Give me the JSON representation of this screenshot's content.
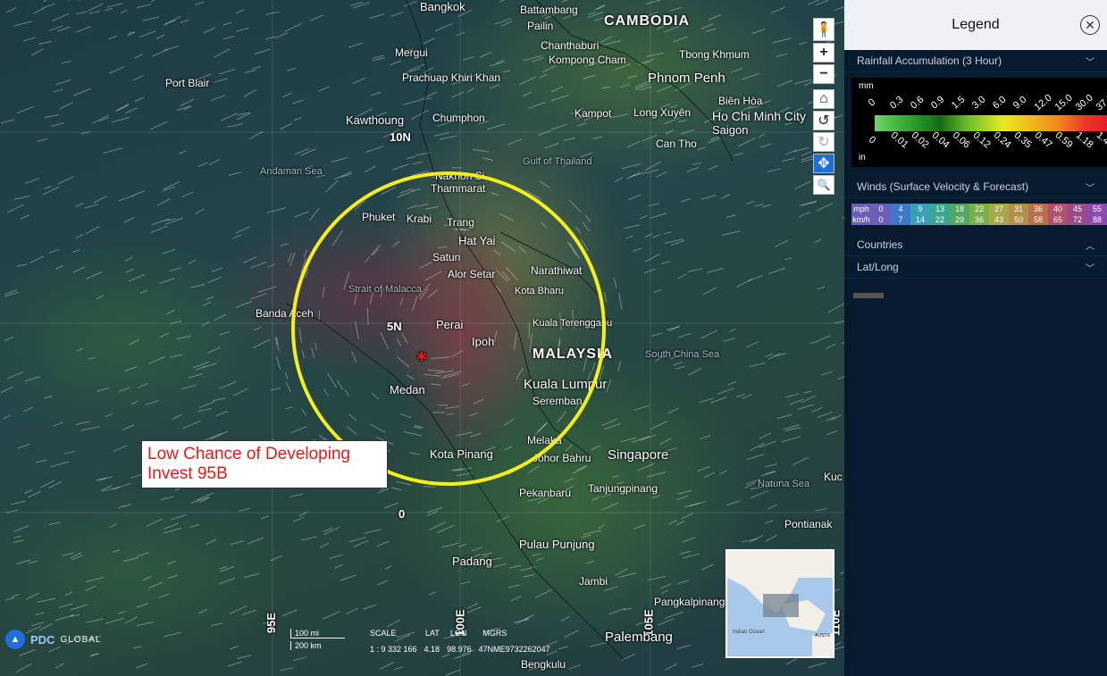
{
  "map": {
    "labels": {
      "bangkok": "Bangkok",
      "battambang": "Battambang",
      "pailin": "Pailin",
      "cambodia": "CAMBODIA",
      "chanthaburi": "Chanthaburi",
      "kompong_cham": "Kompong Cham",
      "tbong_khmum": "Tbong Khmum",
      "mergui": "Mergui",
      "prachuap": "Prachuap Khiri Khan",
      "phnom_penh": "Phnom Penh",
      "port_blair": "Port Blair",
      "bien_hoa": "Biên Hòa",
      "hcmc": "Ho Chi Minh City",
      "saigon": "Saigon",
      "kawthoung": "Kawthoung",
      "chumphon": "Chumphon",
      "kampot": "Kampot",
      "long_xuyen": "Long Xuyên",
      "lat10": "10N",
      "can_tho": "Can Tho",
      "andaman": "Andaman Sea",
      "gulf": "Gulf of Thailand",
      "nakhon": "Nakhon Si",
      "thammarat": "Thammarat",
      "phuket": "Phuket",
      "krabi": "Krabi",
      "trang": "Trang",
      "hat_yai": "Hat Yai",
      "satun": "Satun",
      "alor_setar": "Alor Setar",
      "narathiwat": "Narathiwat",
      "strait": "Strait of Malacca",
      "kota_bharu": "Kota Bharu",
      "banda_aceh": "Banda Aceh",
      "lat5": "5N",
      "perai": "Perai",
      "kuala_terengganu": "Kuala Terengganu",
      "ipoh": "Ipoh",
      "malaysia": "MALAYSIA",
      "scs": "South China Sea",
      "medan": "Medan",
      "kuala_lumpur": "Kuala Lumpur",
      "seremban": "Seremban",
      "melaka": "Melaka",
      "kota_pinang": "Kota Pinang",
      "johor": "Johor Bahru",
      "singapore": "Singapore",
      "natuna": "Natuna Sea",
      "pekanbaru": "Pekanbaru",
      "tanjung": "Tanjungpinang",
      "lat0": "0",
      "pontianak": "Pontianak",
      "pulau": "Pulau Punjung",
      "padang": "Padang",
      "jambi": "Jambi",
      "pangkal": "Pangkalpinang",
      "lon95": "95E",
      "lon100": "100E",
      "lon105": "105E",
      "lon110": "110E",
      "palembang": "Palembang",
      "bengkulu": "Bengkulu",
      "kuc": "Kuc"
    },
    "callout": {
      "line1": "Low Chance of Developing",
      "line2": "Invest 95B"
    }
  },
  "tools": {
    "person": "🧍",
    "zoom_in": "+",
    "zoom_out": "−",
    "home": "⌂",
    "rotate_left": "↺",
    "rotate_right": "↻",
    "pan": "✥",
    "zoom_box": "🔍"
  },
  "footer": {
    "brand": "PDC",
    "brand_sub": "GLOBAL",
    "scale_mi": "100 mi",
    "scale_km": "200 km",
    "scale_label": "SCALE",
    "lat_label": "LAT",
    "lon_label": "LON",
    "mgrs_label": "MGRS",
    "scale_value": "1 : 9 332 166",
    "lat_value": "4.18",
    "lon_value": "98.976",
    "mgrs_value": "47NME9732262047"
  },
  "minimap": {
    "ocean": "Indian Ocean",
    "austr": "AUSTR"
  },
  "legend": {
    "title": "Legend",
    "rain_section": "Rainfall Accumulation (3 Hour)",
    "rain_mm": "mm",
    "rain_in": "in",
    "rain_mm_ticks": [
      "0",
      "0.3",
      "0.6",
      "0.9",
      "1.5",
      "3.0",
      "6.0",
      "9.0",
      "12.0",
      "15.0",
      "30.0",
      "37.0"
    ],
    "rain_in_ticks": [
      "0",
      "0.01",
      "0.02",
      "0.04",
      "0.06",
      "0.12",
      "0.24",
      "0.35",
      "0.47",
      "0.59",
      "1.18",
      "1.46"
    ],
    "wind_section": "Winds (Surface Velocity & Forecast)",
    "wind_mph_label": "mph",
    "wind_kmh_label": "km/h",
    "wind_mph": [
      "0",
      "4",
      "9",
      "13",
      "18",
      "22",
      "27",
      "31",
      "36",
      "40",
      "45",
      "55"
    ],
    "wind_kmh": [
      "0",
      "7",
      "14",
      "22",
      "29",
      "36",
      "43",
      "50",
      "58",
      "65",
      "72",
      "88"
    ],
    "wind_colors": [
      "#6a5fb8",
      "#3f78c8",
      "#3aa0b8",
      "#3aa890",
      "#52a860",
      "#7cae4c",
      "#a6a84a",
      "#b0904a",
      "#b8704a",
      "#b0506a",
      "#9a4a8a",
      "#8a4ab0"
    ],
    "countries": "Countries",
    "latlong": "Lat/Long"
  }
}
